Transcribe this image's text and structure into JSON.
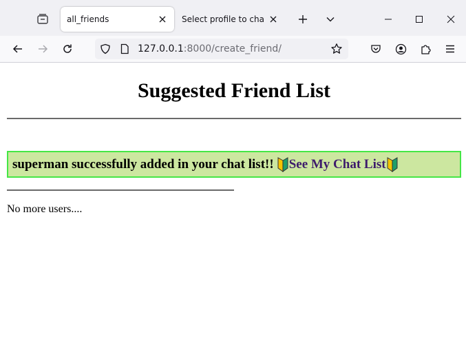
{
  "browser": {
    "tabs": [
      {
        "label": "all_friends",
        "active": true
      },
      {
        "label": "Select profile to change | Dja",
        "active": false
      }
    ],
    "url": {
      "host": "127.0.0.1",
      "rest": ":8000/create_friend/"
    }
  },
  "page": {
    "title": "Suggested Friend List",
    "alert": {
      "message": "superman successfully added in your chat list!!",
      "link_text": "See My Chat List",
      "icon": "japanese-beginner-symbol"
    },
    "empty_text": "No more users...."
  },
  "colors": {
    "alert_bg": "#cce7a0",
    "alert_border": "#45e645",
    "link": "#3d1b6b"
  }
}
